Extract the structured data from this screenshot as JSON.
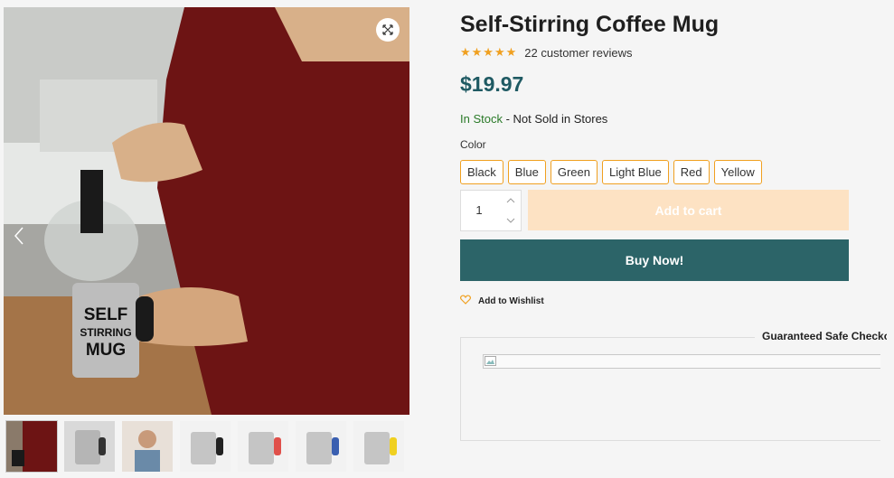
{
  "product": {
    "title": "Self-Stirring Coffee Mug",
    "rating_stars": "★★★★★",
    "reviews": "22 customer reviews",
    "price": "$19.97",
    "stock_status": "In Stock",
    "stock_note": " - Not Sold in Stores"
  },
  "image": {
    "mug_text_line1": "SELF",
    "mug_text_line2": "STIRRING",
    "mug_text_line3": "MUG"
  },
  "options": {
    "color_label": "Color",
    "colors": [
      "Black",
      "Blue",
      "Green",
      "Light Blue",
      "Red",
      "Yellow"
    ]
  },
  "cart": {
    "quantity": "1",
    "add_to_cart": "Add to cart",
    "buy_now": "Buy Now!",
    "wishlist": "Add to Wishlist"
  },
  "checkout": {
    "title": "Guaranteed Safe Checkout"
  },
  "colors_theme": {
    "accent": "#f0a020",
    "primary": "#2c6468",
    "price": "#1f5a63",
    "in_stock": "#2a7a28"
  }
}
